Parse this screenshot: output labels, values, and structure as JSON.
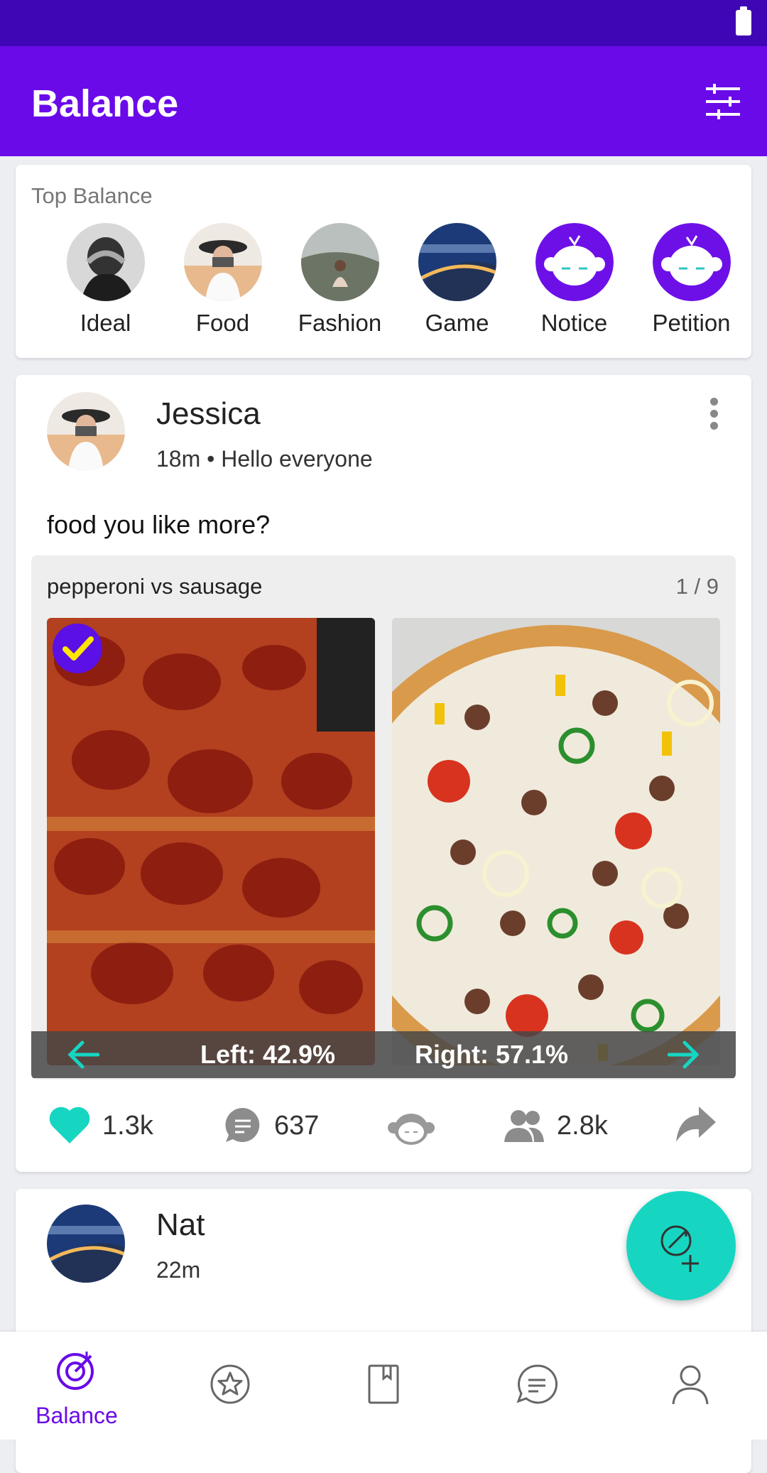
{
  "app": {
    "title": "Balance"
  },
  "top_balance": {
    "label": "Top Balance",
    "items": [
      {
        "label": "Ideal",
        "icon": "person-photo"
      },
      {
        "label": "Food",
        "icon": "photographer-photo"
      },
      {
        "label": "Fashion",
        "icon": "hillside-photo"
      },
      {
        "label": "Game",
        "icon": "bridge-night-photo"
      },
      {
        "label": "Notice",
        "icon": "monkey-logo"
      },
      {
        "label": "Petition",
        "icon": "monkey-logo"
      }
    ]
  },
  "post1": {
    "author": "Jessica",
    "meta": "18m • Hello everyone",
    "question": "food you like more?",
    "vs_title": "pepperoni vs sausage",
    "vs_count": "1 / 9",
    "left_result": "Left: 42.9%",
    "right_result": "Right: 57.1%",
    "likes": "1.3k",
    "comments": "637",
    "participants": "2.8k"
  },
  "post2": {
    "author": "Nat",
    "meta": "22m"
  },
  "nav": {
    "balance_label": "Balance"
  },
  "colors": {
    "primary": "#6a0ae8",
    "status": "#3f06b5",
    "accent": "#16d6c2"
  }
}
